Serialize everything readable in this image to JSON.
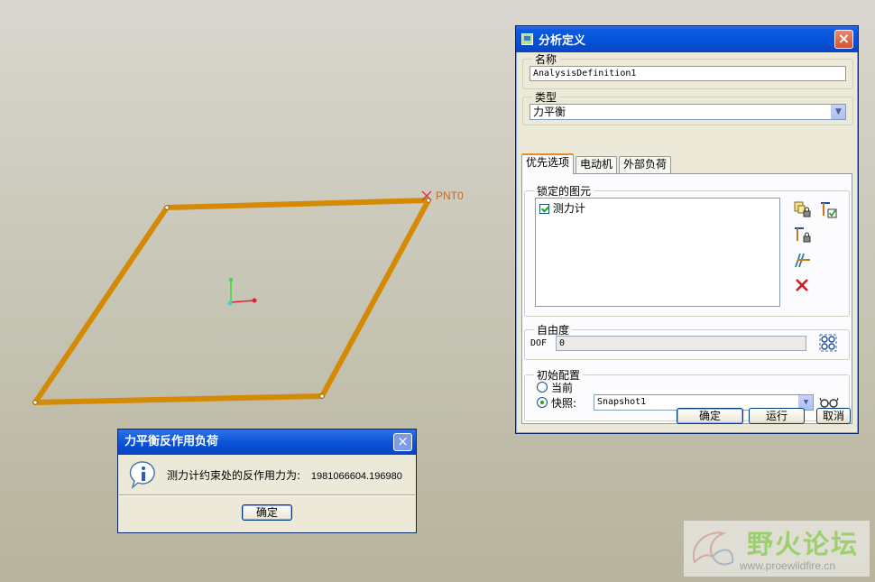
{
  "viewport": {
    "point_label": "PNT0",
    "colors": {
      "frame": "#d48a05",
      "axis_x": "#e0203a",
      "axis_y": "#3bdc3b",
      "point_marker": "#d43a2a"
    }
  },
  "dialog": {
    "title": "分析定义",
    "name_group": {
      "label": "名称",
      "value": "AnalysisDefinition1"
    },
    "type_group": {
      "label": "类型",
      "value": "力平衡"
    },
    "tabs": [
      {
        "label": "优先选项"
      },
      {
        "label": "电动机"
      },
      {
        "label": "外部负荷"
      }
    ],
    "locked_group": {
      "label": "锁定的图元",
      "items": [
        {
          "label": "测力计",
          "checked": true
        }
      ]
    },
    "dof_group": {
      "label": "自由度",
      "field_label": "DOF",
      "value": "0"
    },
    "init_group": {
      "label": "初始配置",
      "current_label": "当前",
      "snapshot_label": "快照:",
      "snapshot_value": "Snapshot1",
      "selected": "snapshot"
    },
    "buttons": {
      "ok": "确定",
      "run": "运行",
      "cancel": "取消"
    },
    "colors": {
      "title_bar": "#0651d6",
      "delete_icon": "#cc1f1f"
    }
  },
  "message_box": {
    "title": "力平衡反作用负荷",
    "message": "测力计约束处的反作用力为:",
    "value": "1981066604.196980",
    "ok": "确定"
  },
  "watermark": {
    "title": "野火论坛",
    "url": "www.proewildfire.cn"
  }
}
